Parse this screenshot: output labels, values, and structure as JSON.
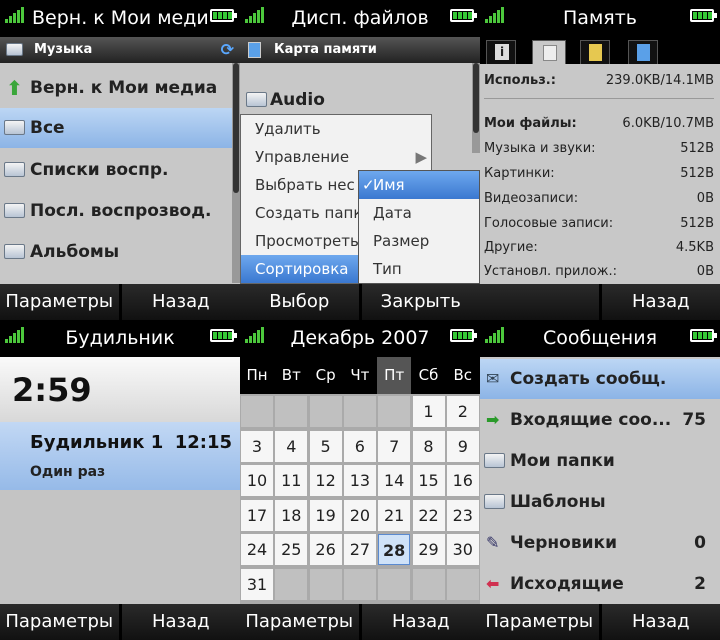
{
  "media": {
    "title": "Верн. к Мои медиа",
    "subbar": "Музыка",
    "items": [
      "Верн. к Мои медиа",
      "Все",
      "Списки воспр.",
      "Посл. воспрозвод.",
      "Альбомы"
    ],
    "soft_left": "Параметры",
    "soft_right": "Назад"
  },
  "files": {
    "title": "Дисп. файлов",
    "subbar": "Карта памяти",
    "folder": "Audio",
    "menu": [
      "Удалить",
      "Управление",
      "Выбрать нес",
      "Создать папк",
      "Просмотреть",
      "Сортировка"
    ],
    "submenu": [
      "Имя",
      "Дата",
      "Размер",
      "Тип"
    ],
    "soft_left": "Выбор",
    "soft_right": "Закрыть"
  },
  "memory": {
    "title": "Память",
    "used_label": "Использ.:",
    "used_value": "239.0KB/14.1MB",
    "rows": [
      {
        "k": "Мои файлы:",
        "v": "6.0KB/10.7MB"
      },
      {
        "k": "Музыка и звуки:",
        "v": "512B"
      },
      {
        "k": "Картинки:",
        "v": "512B"
      },
      {
        "k": "Видеозаписи:",
        "v": "0B"
      },
      {
        "k": "Голосовые записи:",
        "v": "512B"
      },
      {
        "k": "Другие:",
        "v": "4.5KB"
      },
      {
        "k": "Установл. прилож.:",
        "v": "0B"
      }
    ],
    "soft_right": "Назад"
  },
  "alarm": {
    "title": "Будильник",
    "time": "2:59",
    "name": "Будильник 1",
    "alarm_time": "12:15",
    "repeat": "Один раз",
    "soft_left": "Параметры",
    "soft_right": "Назад"
  },
  "calendar": {
    "title": "Декабрь 2007",
    "weekdays": [
      "Пн",
      "Вт",
      "Ср",
      "Чт",
      "Пт",
      "Сб",
      "Вс"
    ],
    "days": [
      "",
      "",
      "",
      "",
      "",
      "1",
      "2",
      "3",
      "4",
      "5",
      "6",
      "7",
      "8",
      "9",
      "10",
      "11",
      "12",
      "13",
      "14",
      "15",
      "16",
      "17",
      "18",
      "19",
      "20",
      "21",
      "22",
      "23",
      "24",
      "25",
      "26",
      "27",
      "28",
      "29",
      "30",
      "31",
      "",
      "",
      "",
      "",
      "",
      ""
    ],
    "soft_left": "Параметры",
    "soft_right": "Назад"
  },
  "messages": {
    "title": "Сообщения",
    "items": [
      {
        "label": "Создать сообщ.",
        "count": ""
      },
      {
        "label": "Входящие соо...",
        "count": "75"
      },
      {
        "label": "Мои папки",
        "count": ""
      },
      {
        "label": "Шаблоны",
        "count": ""
      },
      {
        "label": "Черновики",
        "count": "0"
      },
      {
        "label": "Исходящие",
        "count": "2"
      }
    ],
    "soft_left": "Параметры",
    "soft_right": "Назад"
  },
  "colors": {
    "highlight": "#8cb4e6",
    "signal": "#4cc83c",
    "battery": "#36c836"
  }
}
